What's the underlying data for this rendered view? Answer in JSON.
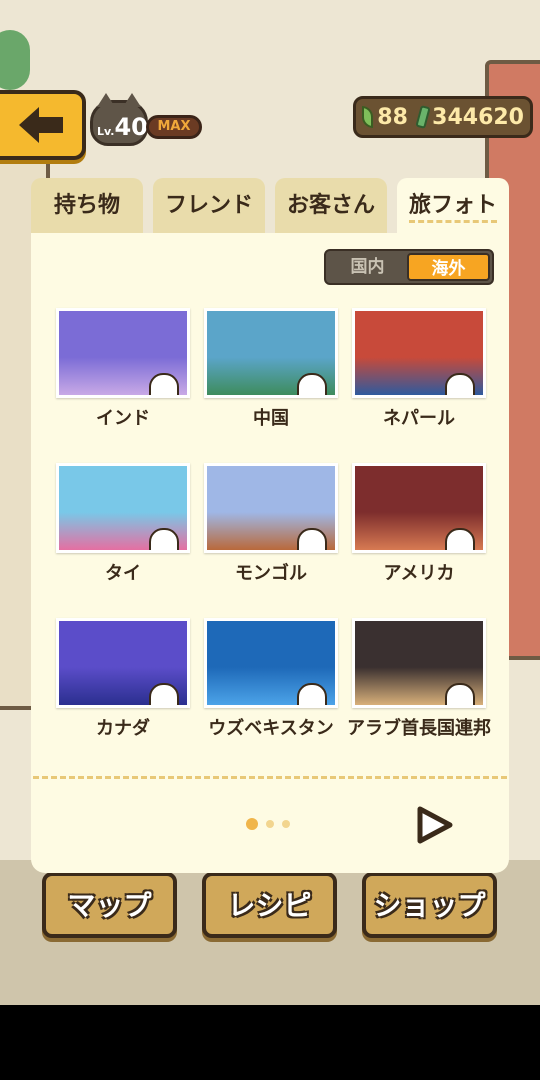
{
  "hud": {
    "level_prefix": "Lv.",
    "level": "40",
    "max_label": "MAX",
    "leaf_count": "88",
    "money": "344620"
  },
  "tabs": [
    {
      "label": "持ち物"
    },
    {
      "label": "フレンド"
    },
    {
      "label": "お客さん"
    },
    {
      "label": "旅フォト",
      "active": true
    }
  ],
  "region_toggle": {
    "domestic": "国内",
    "overseas": "海外",
    "selected": "海外"
  },
  "photos": [
    {
      "label": "インド",
      "palette": [
        "#7b6cd6",
        "#c8a9e6"
      ]
    },
    {
      "label": "中国",
      "palette": [
        "#5ba5c9",
        "#3e8c5d"
      ]
    },
    {
      "label": "ネパール",
      "palette": [
        "#c84a3a",
        "#2f5a9e"
      ]
    },
    {
      "label": "タイ",
      "palette": [
        "#79c8e8",
        "#e56fa1"
      ]
    },
    {
      "label": "モンゴル",
      "palette": [
        "#9fb7e6",
        "#b9693b"
      ]
    },
    {
      "label": "アメリカ",
      "palette": [
        "#7d2d2d",
        "#d77a52"
      ]
    },
    {
      "label": "カナダ",
      "palette": [
        "#5b4dc9",
        "#2b2f8f"
      ]
    },
    {
      "label": "ウズベキスタン",
      "palette": [
        "#1e69b8",
        "#4ca3e8"
      ]
    },
    {
      "label": "アラブ首長国連邦",
      "palette": [
        "#3a3030",
        "#d8b07a"
      ]
    }
  ],
  "pagination": {
    "current": 1,
    "total": 3
  },
  "bottom_nav": [
    {
      "label": "マップ"
    },
    {
      "label": "レシピ"
    },
    {
      "label": "ショップ"
    }
  ]
}
